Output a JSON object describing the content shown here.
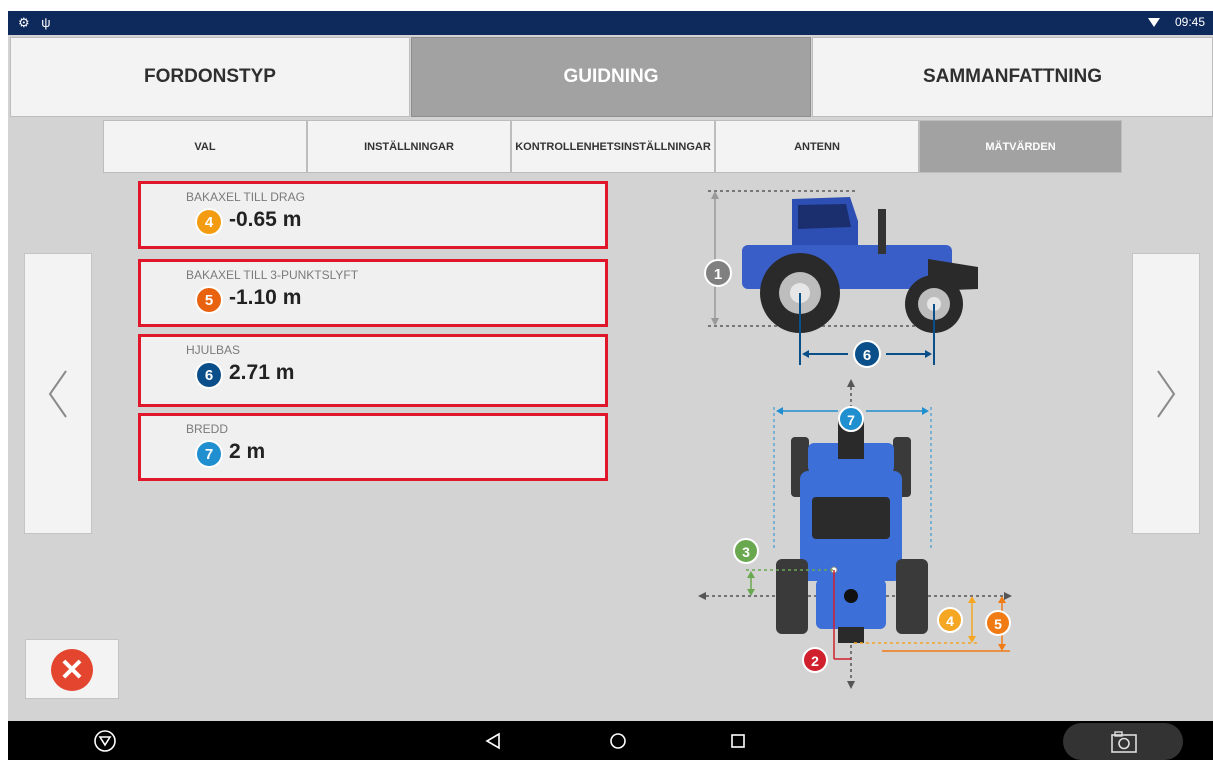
{
  "statusbar": {
    "left_icons": "⚙ ψ",
    "time": "09:45"
  },
  "tabs": [
    {
      "label": "FORDONSTYP"
    },
    {
      "label": "GUIDNING"
    },
    {
      "label": "SAMMANFATTNING"
    }
  ],
  "subtabs": [
    {
      "label": "VAL"
    },
    {
      "label": "INSTÄLLNINGAR"
    },
    {
      "label": "KONTROLLENHETSINSTÄLLNINGAR"
    },
    {
      "label": "ANTENN"
    },
    {
      "label": "MÄTVÄRDEN"
    }
  ],
  "active_tab": "GUIDNING",
  "active_subtab": "MÄTVÄRDEN",
  "measurements": [
    {
      "label": "BAKAXEL TILL DRAG",
      "badge": "4",
      "value": "-0.65 m",
      "color": "#f39c12"
    },
    {
      "label": "BAKAXEL TILL 3-PUNKTSLYFT",
      "badge": "5",
      "value": "-1.10 m",
      "color": "#e8620f"
    },
    {
      "label": "HJULBAS",
      "badge": "6",
      "value": "2.71 m",
      "color": "#0b4f8a"
    },
    {
      "label": "BREDD",
      "badge": "7",
      "value": "2 m",
      "color": "#1f8fd0"
    }
  ],
  "diagram": {
    "markers": [
      "1",
      "2",
      "3",
      "4",
      "5",
      "6",
      "7"
    ],
    "colors": {
      "1": "#808080",
      "2": "#d0202e",
      "3": "#6aa84f",
      "4": "#f5a623",
      "5": "#f07b14",
      "6": "#0b4f8a",
      "7": "#1f8fd0"
    }
  },
  "icons": {
    "prev": "chevron-left-icon",
    "next": "chevron-right-icon",
    "cancel": "close-icon",
    "home": "home-icon",
    "back": "back-icon",
    "recent": "recent-apps-icon",
    "camera": "camera-icon"
  }
}
